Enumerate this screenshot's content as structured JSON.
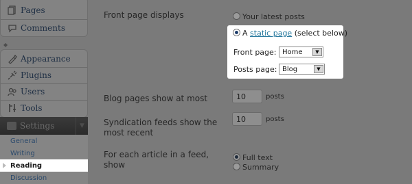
{
  "sidebar": {
    "group1": [
      {
        "label": "Pages",
        "icon": "pages-icon"
      },
      {
        "label": "Comments",
        "icon": "comments-icon"
      }
    ],
    "group2": [
      {
        "label": "Appearance",
        "icon": "appearance-icon"
      },
      {
        "label": "Plugins",
        "icon": "plugins-icon"
      },
      {
        "label": "Users",
        "icon": "users-icon"
      },
      {
        "label": "Tools",
        "icon": "tools-icon"
      }
    ],
    "settings_label": "Settings",
    "submenu": [
      "General",
      "Writing",
      "Reading",
      "Discussion"
    ],
    "active_submenu": "Reading"
  },
  "main": {
    "front_page_displays": {
      "label": "Front page displays",
      "option_latest": "Your latest posts",
      "option_static_prefix": "A",
      "option_static_link": "static page",
      "option_static_suffix": "(select below)",
      "selected": "static"
    },
    "front_page": {
      "label": "Front page:",
      "value": "Home"
    },
    "posts_page": {
      "label": "Posts page:",
      "value": "Blog"
    },
    "blog_pages": {
      "label": "Blog pages show at most",
      "value": "10",
      "unit": "posts"
    },
    "syndication": {
      "label_line1": "Syndication feeds show the",
      "label_line2": "most recent",
      "value": "10",
      "unit": "posts"
    },
    "feed_article": {
      "label_line1": "For each article in a feed,",
      "label_line2": "show",
      "option_full": "Full text",
      "option_summary": "Summary",
      "selected": "full"
    }
  },
  "colors": {
    "overlay": "#7a7a7a",
    "highlight": "#ffffff",
    "link": "#21759b"
  }
}
